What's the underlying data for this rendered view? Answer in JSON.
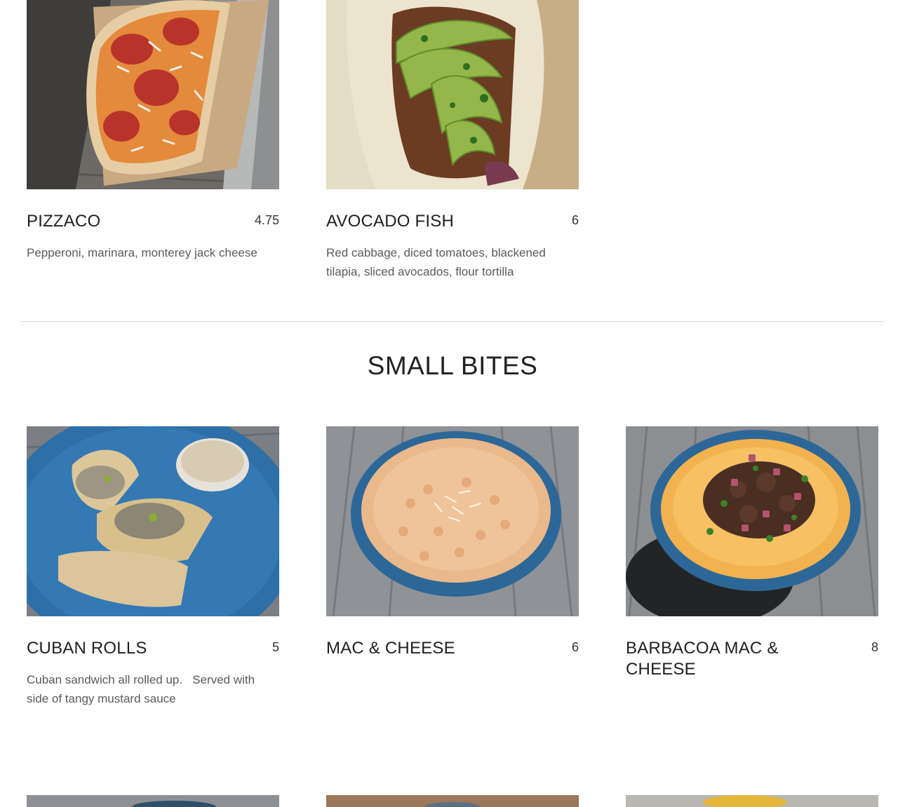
{
  "previous_section": {
    "items": [
      {
        "name": "PIZZACO",
        "price": "4.75",
        "description": "Pepperoni, marinara, monterey jack cheese",
        "photo_icon": "pizza-taco-photo"
      },
      {
        "name": "AVOCADO FISH",
        "price": "6",
        "description": "Red cabbage, diced tomatoes, blackened tilapia, sliced avocados, flour tortilla",
        "photo_icon": "avocado-fish-taco-photo"
      }
    ]
  },
  "small_bites": {
    "title": "SMALL BITES",
    "items": [
      {
        "name": "CUBAN ROLLS",
        "price": "5",
        "description": "Cuban sandwich all rolled up.   Served with side of tangy mustard sauce",
        "photo_icon": "cuban-rolls-photo"
      },
      {
        "name": "MAC & CHEESE",
        "price": "6",
        "description": "",
        "photo_icon": "mac-and-cheese-photo"
      },
      {
        "name": "BARBACOA MAC & CHEESE",
        "price": "8",
        "description": "",
        "photo_icon": "barbacoa-mac-photo"
      }
    ]
  },
  "colors": {
    "text_primary": "#1f1f1f",
    "text_secondary": "#5a5a5a",
    "divider": "#dcdcdc",
    "plate_blue": "#2f6fa8"
  }
}
